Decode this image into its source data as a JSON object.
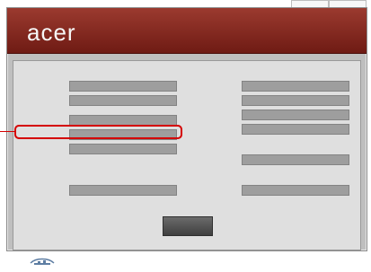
{
  "brand": "acer",
  "left_panel": {
    "title": "",
    "fields": [
      {
        "label": "",
        "value": ""
      },
      {
        "label": "",
        "value": ""
      },
      {
        "label": "",
        "value": ""
      },
      {
        "label": "",
        "value": ""
      },
      {
        "label": "",
        "value": ""
      },
      {
        "label": "",
        "value": ""
      }
    ]
  },
  "right_panel": {
    "title": "",
    "fields": [
      {
        "label": "",
        "value": ""
      },
      {
        "label": "",
        "value": ""
      },
      {
        "label": "",
        "value": ""
      },
      {
        "label": "",
        "value": ""
      },
      {
        "label": "",
        "value": ""
      },
      {
        "label": "",
        "value": ""
      }
    ]
  },
  "button": {
    "label": ""
  },
  "footer": {
    "logo_icon": "acer-gateway-logo-icon",
    "text": ""
  }
}
